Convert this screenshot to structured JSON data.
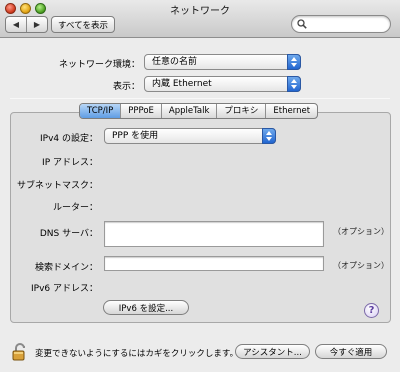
{
  "window": {
    "title": "ネットワーク"
  },
  "toolbar": {
    "back_glyph": "◀",
    "forward_glyph": "▶",
    "show_all_label": "すべてを表示",
    "search_placeholder": "",
    "search_icon": "magnifier-icon"
  },
  "settings": {
    "location_label": "ネットワーク環境：",
    "location_value": "任意の名前",
    "show_label": "表示：",
    "show_value": "内蔵 Ethernet"
  },
  "tabs": [
    "TCP/IP",
    "PPPoE",
    "AppleTalk",
    "プロキシ",
    "Ethernet"
  ],
  "active_tab": "TCP/IP",
  "tcpip": {
    "ipv4_label": "IPv4 の設定：",
    "ipv4_value": "PPP を使用",
    "ip_address_label": "IP アドレス：",
    "subnet_label": "サブネットマスク：",
    "router_label": "ルーター：",
    "dns_label": "DNS サーバ：",
    "dns_value": "",
    "dns_note": "（オプション）",
    "search_domain_label": "検索ドメイン：",
    "search_domain_value": "",
    "search_domain_note": "（オプション）",
    "ipv6_label": "IPv6 アドレス：",
    "ipv6_button": "IPv6 を設定...",
    "help_glyph": "?"
  },
  "footer": {
    "lock_text": "変更できないようにするにはカギをクリックします。",
    "assistant_button": "アシスタント...",
    "apply_button": "今すぐ適用"
  },
  "colors": {
    "accent": "#3b7be0",
    "tab_active": "#8ab8ef",
    "window_bg": "#ececec",
    "panel_bg": "#e0e0e0"
  }
}
